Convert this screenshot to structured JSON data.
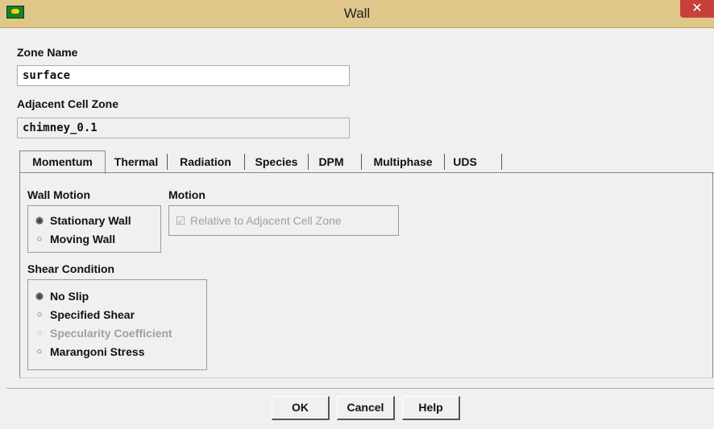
{
  "window": {
    "title": "Wall",
    "close_glyph": "✕",
    "app_icon": "fluent-app-icon"
  },
  "zone_name": {
    "label": "Zone Name",
    "value": "surface"
  },
  "adjacent_zone": {
    "label": "Adjacent Cell Zone",
    "value": "chimney_0.1"
  },
  "tabs": [
    {
      "label": "Momentum",
      "active": true
    },
    {
      "label": "Thermal"
    },
    {
      "label": "Radiation"
    },
    {
      "label": "Species"
    },
    {
      "label": "DPM"
    },
    {
      "label": "Multiphase"
    },
    {
      "label": "UDS"
    }
  ],
  "wall_motion": {
    "label": "Wall Motion",
    "options": [
      {
        "label": "Stationary Wall",
        "selected": true
      },
      {
        "label": "Moving Wall",
        "selected": false
      }
    ]
  },
  "motion": {
    "label": "Motion",
    "checkbox_label": "Relative to Adjacent Cell Zone",
    "checked": true,
    "enabled": false
  },
  "shear_condition": {
    "label": "Shear Condition",
    "options": [
      {
        "label": "No Slip",
        "selected": true,
        "enabled": true
      },
      {
        "label": "Specified Shear",
        "selected": false,
        "enabled": true
      },
      {
        "label": "Specularity Coefficient",
        "selected": false,
        "enabled": false
      },
      {
        "label": "Marangoni Stress",
        "selected": false,
        "enabled": true
      }
    ]
  },
  "buttons": {
    "ok": "OK",
    "cancel": "Cancel",
    "help": "Help"
  },
  "glyphs": {
    "radio_selected": "◉",
    "radio_unselected": "○",
    "check_checked": "☑"
  }
}
